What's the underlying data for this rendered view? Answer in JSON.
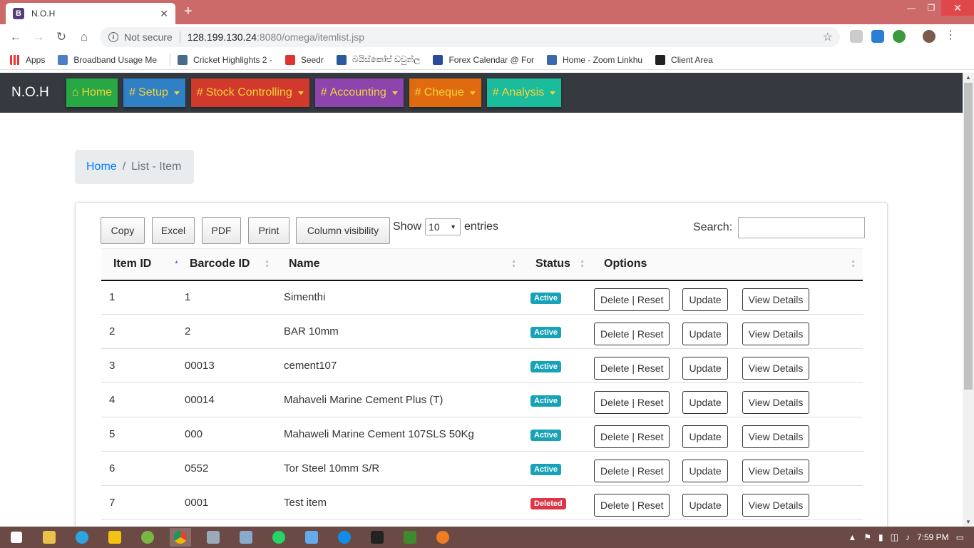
{
  "browser": {
    "tab_title": "N.O.H",
    "tab_favicon": "B",
    "new_tab": "+",
    "url_security": "Not secure",
    "url_host": "128.199.130.24",
    "url_path": ":8080/omega/itemlist.jsp",
    "bookmarks": [
      "Apps",
      "Broadband Usage Me",
      "Cricket Highlights 2 -",
      "Seedr",
      "බයිස්කෝප් ඩවුන්ල",
      "Forex Calendar @ For",
      "Home - Zoom Linkhu",
      "Client Area"
    ]
  },
  "app": {
    "brand": "N.O.H",
    "menu": [
      {
        "label": "Home",
        "color": "#28a745",
        "icon": "home-icon",
        "dropdown": false
      },
      {
        "label": "Setup",
        "color": "#2f80c4",
        "icon": "hash",
        "dropdown": true
      },
      {
        "label": "Stock Controlling",
        "color": "#d0392b",
        "icon": "hash",
        "dropdown": true
      },
      {
        "label": "Accounting",
        "color": "#8e44ad",
        "icon": "hash",
        "dropdown": true
      },
      {
        "label": "Cheque",
        "color": "#e06a10",
        "icon": "hash",
        "dropdown": true
      },
      {
        "label": "Analysis",
        "color": "#1abc9c",
        "icon": "hash",
        "dropdown": true
      }
    ],
    "hash_symbol": "#"
  },
  "breadcrumb": {
    "home": "Home",
    "divider": "/",
    "current": "List - Item"
  },
  "datatable": {
    "buttons": [
      "Copy",
      "Excel",
      "PDF",
      "Print",
      "Column visibility"
    ],
    "show_label": "Show",
    "entries_value": "10",
    "entries_label": "entries",
    "search_label": "Search:",
    "search_value": "",
    "columns": [
      "Item ID",
      "Barcode ID",
      "Name",
      "Status",
      "Options"
    ],
    "option_buttons": [
      "Delete | Reset",
      "Update",
      "View Details"
    ],
    "rows": [
      {
        "id": "1",
        "barcode": "1",
        "name": "Simenthi",
        "status": "Active"
      },
      {
        "id": "2",
        "barcode": "2",
        "name": "BAR 10mm",
        "status": "Active"
      },
      {
        "id": "3",
        "barcode": "00013",
        "name": "cement107",
        "status": "Active"
      },
      {
        "id": "4",
        "barcode": "00014",
        "name": "Mahaveli Marine Cement Plus (T)",
        "status": "Active"
      },
      {
        "id": "5",
        "barcode": "000",
        "name": "Mahaweli Marine Cement 107SLS 50Kg",
        "status": "Active"
      },
      {
        "id": "6",
        "barcode": "0552",
        "name": "Tor Steel 10mm S/R",
        "status": "Active"
      },
      {
        "id": "7",
        "barcode": "0001",
        "name": "Test item",
        "status": "Deleted"
      }
    ]
  },
  "taskbar": {
    "time": "7:59 PM"
  }
}
